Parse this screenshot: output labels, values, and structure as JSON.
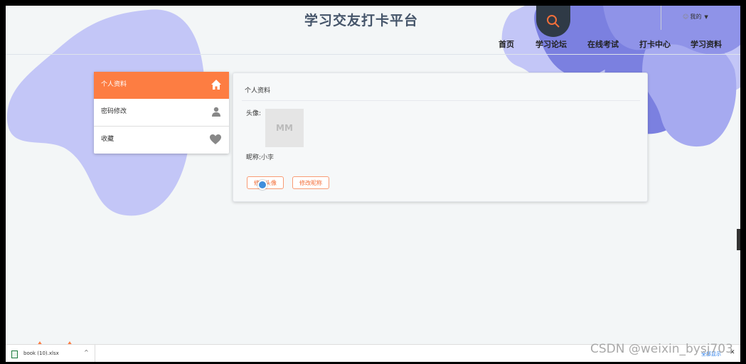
{
  "header": {
    "title": "学习交友打卡平台",
    "user_menu": "我的"
  },
  "nav": [
    "首页",
    "学习论坛",
    "在线考试",
    "打卡中心",
    "学习资料"
  ],
  "sidebar": {
    "items": [
      {
        "label": "个人资料",
        "icon": "home-icon",
        "active": true
      },
      {
        "label": "密码修改",
        "icon": "person-icon",
        "active": false
      },
      {
        "label": "收藏",
        "icon": "heart-icon",
        "active": false
      }
    ]
  },
  "profile": {
    "title": "个人资料",
    "avatar_label": "头像:",
    "avatar_placeholder": "MM",
    "nickname_label": "昵称:",
    "nickname_value": "小李",
    "edit_avatar_button": "修改头像",
    "edit_nickname_button": "修改昵称"
  },
  "download_bar": {
    "file_name": "book (10).xlsx",
    "show_all": "全部显示"
  },
  "watermark": "CSDN @weixin_bysj703",
  "colors": {
    "accent": "#fd7d42",
    "blob_light": "#c3c6f7",
    "blob_dark": "#7b80e0",
    "search_bg": "#2f3a46"
  }
}
